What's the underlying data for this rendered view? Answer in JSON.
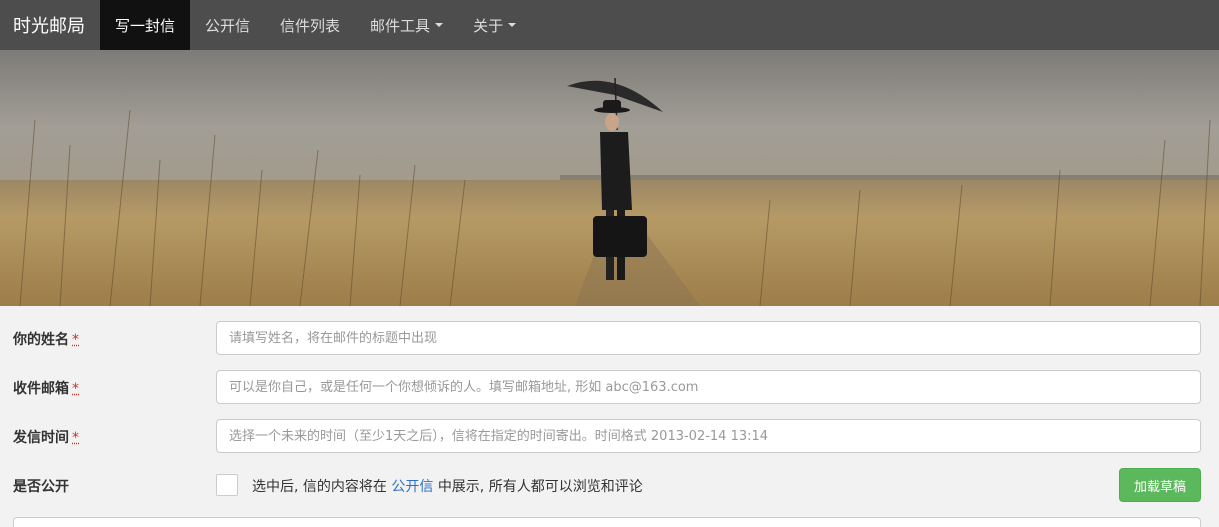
{
  "navbar": {
    "brand": "时光邮局",
    "items": [
      {
        "label": "写一封信"
      },
      {
        "label": "公开信"
      },
      {
        "label": "信件列表"
      },
      {
        "label": "邮件工具"
      },
      {
        "label": "关于"
      }
    ]
  },
  "hero": {
    "icon": "landscape-photo"
  },
  "form": {
    "name": {
      "label": "你的姓名",
      "required_mark": "*",
      "placeholder": "请填写姓名，将在邮件的标题中出现",
      "value": ""
    },
    "email": {
      "label": "收件邮箱",
      "required_mark": "*",
      "placeholder": "可以是你自己，或是任何一个你想倾诉的人。填写邮箱地址, 形如 abc@163.com",
      "value": ""
    },
    "time": {
      "label": "发信时间",
      "required_mark": "*",
      "placeholder": "选择一个未来的时间（至少1天之后），信将在指定的时间寄出。时间格式 2013-02-14 13:14",
      "value": ""
    },
    "public": {
      "label": "是否公开",
      "checked": false,
      "text_before": "选中后, 信的内容将在",
      "link": "公开信",
      "text_after": "中展示, 所有人都可以浏览和评论"
    },
    "draft_button": "加载草稿"
  },
  "colors": {
    "navbar": "#4d4d4d",
    "active_nav": "#111111",
    "success": "#5cb85c",
    "link": "#2a6fc9"
  }
}
